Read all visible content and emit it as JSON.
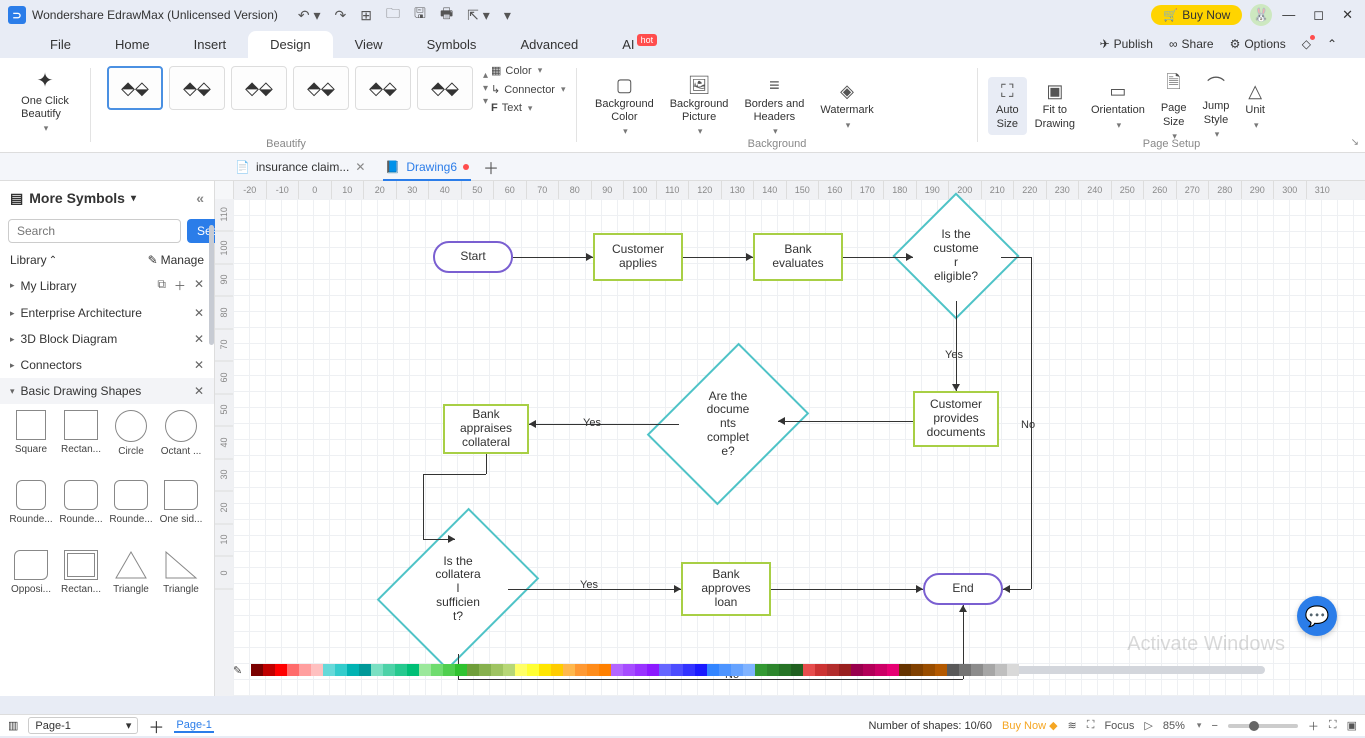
{
  "titlebar": {
    "app_name": "Wondershare EdrawMax (Unlicensed Version)",
    "buy_now": "Buy Now"
  },
  "menu": {
    "items": [
      "File",
      "Home",
      "Insert",
      "Design",
      "View",
      "Symbols",
      "Advanced"
    ],
    "ai": "AI",
    "hot": "hot",
    "right": {
      "publish": "Publish",
      "share": "Share",
      "options": "Options"
    }
  },
  "ribbon": {
    "one_click": "One Click\nBeautify",
    "color": "Color",
    "connector": "Connector",
    "text": "Text",
    "bg_color": "Background\nColor",
    "bg_pic": "Background\nPicture",
    "borders": "Borders and\nHeaders",
    "watermark": "Watermark",
    "auto_size": "Auto\nSize",
    "fit": "Fit to\nDrawing",
    "orientation": "Orientation",
    "page_size": "Page\nSize",
    "jump": "Jump\nStyle",
    "unit": "Unit",
    "groups": {
      "beautify": "Beautify",
      "background": "Background",
      "page_setup": "Page Setup"
    }
  },
  "doctabs": {
    "tab1": "insurance claim...",
    "tab2": "Drawing6"
  },
  "sidebar": {
    "title": "More Symbols",
    "search_placeholder": "Search",
    "search_btn": "Search",
    "library": "Library",
    "manage": "Manage",
    "items": [
      "My Library",
      "Enterprise Architecture",
      "3D Block Diagram",
      "Connectors",
      "Basic Drawing Shapes"
    ],
    "shapes": [
      "Square",
      "Rectan...",
      "Circle",
      "Octant ...",
      "Rounde...",
      "Rounde...",
      "Rounde...",
      "One sid...",
      "Opposi...",
      "Rectan...",
      "Triangle",
      "Triangle"
    ]
  },
  "ruler_h": [
    "-20",
    "-10",
    "0",
    "10",
    "20",
    "30",
    "40",
    "50",
    "60",
    "70",
    "80",
    "90",
    "100",
    "110",
    "120",
    "130",
    "140",
    "150",
    "160",
    "170",
    "180",
    "190",
    "200",
    "210",
    "220",
    "230",
    "240",
    "250",
    "260",
    "270",
    "280",
    "290",
    "300",
    "310"
  ],
  "ruler_v": [
    "110",
    "100",
    "90",
    "80",
    "70",
    "60",
    "50",
    "40",
    "30",
    "20",
    "10",
    "0"
  ],
  "flow": {
    "start": "Start",
    "customer_applies": "Customer\napplies",
    "bank_evaluates": "Bank\nevaluates",
    "is_eligible": "Is the\ncustome\nr\neligible?",
    "customer_provides": "Customer\nprovides\ndocuments",
    "docs_complete": "Are the\ndocume\nnts\ncomplet\ne?",
    "bank_appraises": "Bank\nappraises\ncollateral",
    "is_sufficient": "Is the\ncollatera\nl\nsufficien\nt?",
    "bank_approves": "Bank\napproves\nloan",
    "end": "End",
    "yes": "Yes",
    "no": "No"
  },
  "status": {
    "page": "Page-1",
    "page_tab": "Page-1",
    "shapes": "Number of shapes: 10/60",
    "buy": "Buy Now",
    "focus": "Focus",
    "zoom": "85%"
  },
  "watermark": "Activate Windows",
  "palette": [
    "#7a0000",
    "#c00000",
    "#ff0000",
    "#ff6b6b",
    "#ff9e9e",
    "#ffc0c0",
    "#66d9d9",
    "#33cccc",
    "#00b3b3",
    "#009999",
    "#7ae0c3",
    "#4dd2a8",
    "#26c98f",
    "#00bf76",
    "#9be89b",
    "#6fdc6f",
    "#4fcf4f",
    "#2fc22f",
    "#6f9e3a",
    "#87b14e",
    "#9fc462",
    "#b7d776",
    "#ffff66",
    "#ffff33",
    "#ffe600",
    "#ffcc00",
    "#ffb84d",
    "#ff9933",
    "#ff8c1a",
    "#ff8000",
    "#b366ff",
    "#a64dff",
    "#9933ff",
    "#8c1aff",
    "#6666ff",
    "#4d4dff",
    "#3333ff",
    "#1a1aff",
    "#3385ff",
    "#4d94ff",
    "#66a3ff",
    "#80b3ff",
    "#339933",
    "#2d862d",
    "#267326",
    "#206020",
    "#e64d4d",
    "#cc3333",
    "#b32d2d",
    "#991f1f",
    "#99004d",
    "#b30059",
    "#cc0066",
    "#e60073",
    "#663300",
    "#804000",
    "#994d00",
    "#b35900",
    "#595959",
    "#737373",
    "#8c8c8c",
    "#a6a6a6",
    "#bfbfbf",
    "#d9d9d9"
  ]
}
